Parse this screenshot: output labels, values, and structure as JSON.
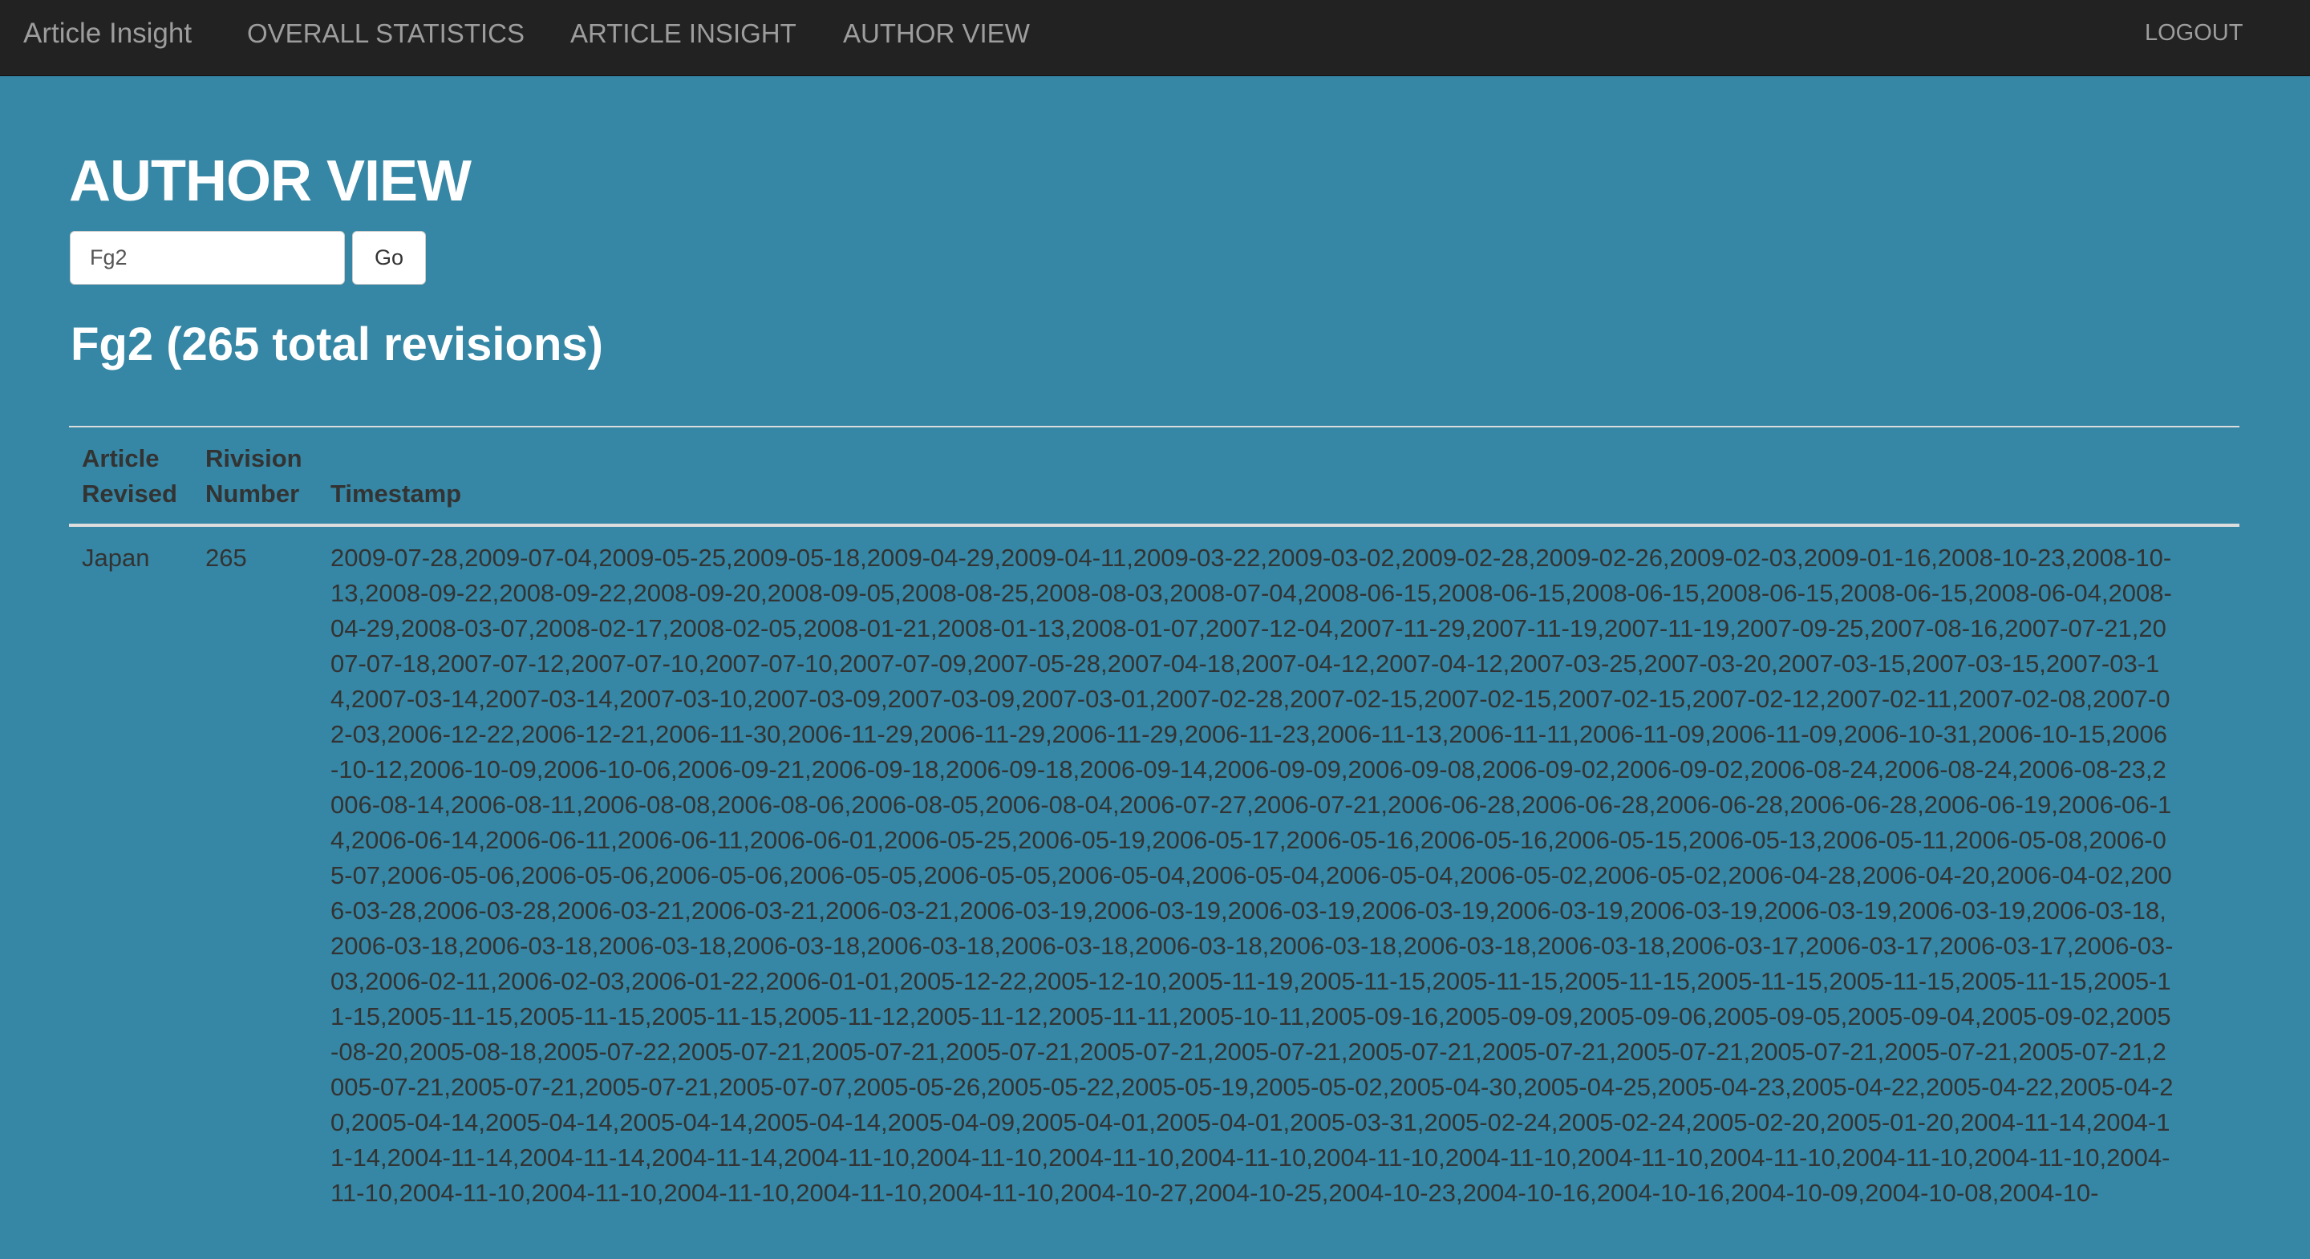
{
  "navbar": {
    "brand": "Article Insight",
    "links": [
      "OVERALL STATISTICS",
      "ARTICLE INSIGHT",
      "AUTHOR VIEW"
    ],
    "logout": "LOGOUT"
  },
  "page": {
    "title": "AUTHOR VIEW"
  },
  "search": {
    "value": "Fg2",
    "go_label": "Go"
  },
  "result": {
    "heading": "Fg2 (265 total revisions)"
  },
  "table": {
    "headers": {
      "article_line1": "Article",
      "article_line2": "Revised",
      "revision_line1": "Rivision",
      "revision_line2": "Number",
      "timestamp": "Timestamp"
    },
    "rows": [
      {
        "article": "Japan",
        "revision_number": "265",
        "timestamps": "2009-07-28,2009-07-04,2009-05-25,2009-05-18,2009-04-29,2009-04-11,2009-03-22,2009-03-02,2009-02-28,2009-02-26,2009-02-03,2009-01-16,2008-10-23,2008-10-13,2008-09-22,2008-09-22,2008-09-20,2008-09-05,2008-08-25,2008-08-03,2008-07-04,2008-06-15,2008-06-15,2008-06-15,2008-06-15,2008-06-15,2008-06-04,2008-04-29,2008-03-07,2008-02-17,2008-02-05,2008-01-21,2008-01-13,2008-01-07,2007-12-04,2007-11-29,2007-11-19,2007-11-19,2007-09-25,2007-08-16,2007-07-21,2007-07-18,2007-07-12,2007-07-10,2007-07-10,2007-07-09,2007-05-28,2007-04-18,2007-04-12,2007-04-12,2007-03-25,2007-03-20,2007-03-15,2007-03-15,2007-03-14,2007-03-14,2007-03-14,2007-03-10,2007-03-09,2007-03-09,2007-03-01,2007-02-28,2007-02-15,2007-02-15,2007-02-15,2007-02-12,2007-02-11,2007-02-08,2007-02-03,2006-12-22,2006-12-21,2006-11-30,2006-11-29,2006-11-29,2006-11-29,2006-11-23,2006-11-13,2006-11-11,2006-11-09,2006-11-09,2006-10-31,2006-10-15,2006-10-12,2006-10-09,2006-10-06,2006-09-21,2006-09-18,2006-09-18,2006-09-14,2006-09-09,2006-09-08,2006-09-02,2006-09-02,2006-08-24,2006-08-24,2006-08-23,2006-08-14,2006-08-11,2006-08-08,2006-08-06,2006-08-05,2006-08-04,2006-07-27,2006-07-21,2006-06-28,2006-06-28,2006-06-28,2006-06-28,2006-06-19,2006-06-14,2006-06-14,2006-06-11,2006-06-11,2006-06-01,2006-05-25,2006-05-19,2006-05-17,2006-05-16,2006-05-16,2006-05-15,2006-05-13,2006-05-11,2006-05-08,2006-05-07,2006-05-06,2006-05-06,2006-05-06,2006-05-05,2006-05-05,2006-05-04,2006-05-04,2006-05-04,2006-05-02,2006-05-02,2006-04-28,2006-04-20,2006-04-02,2006-03-28,2006-03-28,2006-03-21,2006-03-21,2006-03-21,2006-03-19,2006-03-19,2006-03-19,2006-03-19,2006-03-19,2006-03-19,2006-03-19,2006-03-19,2006-03-18,2006-03-18,2006-03-18,2006-03-18,2006-03-18,2006-03-18,2006-03-18,2006-03-18,2006-03-18,2006-03-18,2006-03-18,2006-03-17,2006-03-17,2006-03-17,2006-03-03,2006-02-11,2006-02-03,2006-01-22,2006-01-01,2005-12-22,2005-12-10,2005-11-19,2005-11-15,2005-11-15,2005-11-15,2005-11-15,2005-11-15,2005-11-15,2005-11-15,2005-11-15,2005-11-15,2005-11-15,2005-11-12,2005-11-12,2005-11-11,2005-10-11,2005-09-16,2005-09-09,2005-09-06,2005-09-05,2005-09-04,2005-09-02,2005-08-20,2005-08-18,2005-07-22,2005-07-21,2005-07-21,2005-07-21,2005-07-21,2005-07-21,2005-07-21,2005-07-21,2005-07-21,2005-07-21,2005-07-21,2005-07-21,2005-07-21,2005-07-21,2005-07-21,2005-07-07,2005-05-26,2005-05-22,2005-05-19,2005-05-02,2005-04-30,2005-04-25,2005-04-23,2005-04-22,2005-04-22,2005-04-20,2005-04-14,2005-04-14,2005-04-14,2005-04-14,2005-04-09,2005-04-01,2005-04-01,2005-03-31,2005-02-24,2005-02-24,2005-02-20,2005-01-20,2004-11-14,2004-11-14,2004-11-14,2004-11-14,2004-11-14,2004-11-10,2004-11-10,2004-11-10,2004-11-10,2004-11-10,2004-11-10,2004-11-10,2004-11-10,2004-11-10,2004-11-10,2004-11-10,2004-11-10,2004-11-10,2004-11-10,2004-11-10,2004-11-10,2004-10-27,2004-10-25,2004-10-23,2004-10-16,2004-10-16,2004-10-09,2004-10-08,2004-10-"
      }
    ]
  }
}
